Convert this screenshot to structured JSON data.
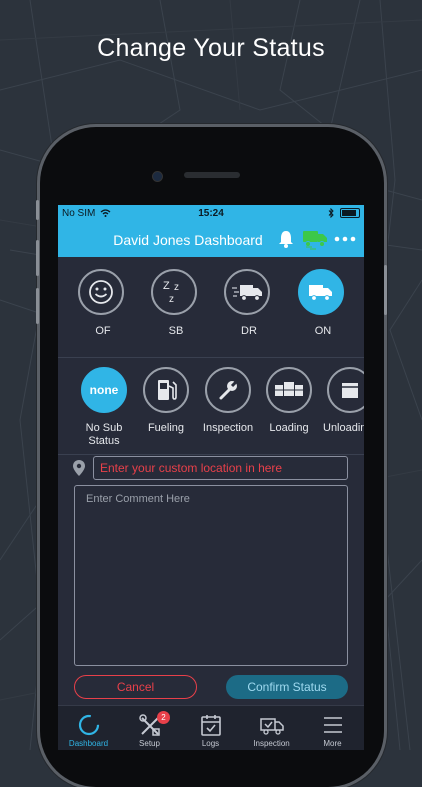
{
  "headline": "Change Your Status",
  "status_bar": {
    "carrier": "No SIM",
    "time": "15:24"
  },
  "nav": {
    "title": "David Jones Dashboard"
  },
  "statuses": [
    {
      "code": "OF",
      "icon": "smiley-icon",
      "active": false
    },
    {
      "code": "SB",
      "icon": "sleep-zzz-icon",
      "active": false
    },
    {
      "code": "DR",
      "icon": "moving-truck-icon",
      "active": false
    },
    {
      "code": "ON",
      "icon": "truck-icon",
      "active": true
    }
  ],
  "sub_statuses": [
    {
      "label": "No Sub Status",
      "circle_text": "none",
      "active": true
    },
    {
      "label": "Fueling",
      "icon": "fuel-pump-icon"
    },
    {
      "label": "Inspection",
      "icon": "wrench-icon"
    },
    {
      "label": "Loading",
      "icon": "boxes-icon"
    },
    {
      "label": "Unloading",
      "icon": "box-icon"
    }
  ],
  "location": {
    "placeholder": "Enter your custom location in here"
  },
  "comment": {
    "placeholder": "Enter Comment Here"
  },
  "buttons": {
    "cancel": "Cancel",
    "confirm": "Confirm Status"
  },
  "tabs": [
    {
      "label": "Dashboard",
      "active": true
    },
    {
      "label": "Setup",
      "badge": "2"
    },
    {
      "label": "Logs"
    },
    {
      "label": "Inspection"
    },
    {
      "label": "More"
    }
  ],
  "colors": {
    "accent": "#30b5e6",
    "danger": "#e8404a",
    "background": "#272b39",
    "success": "#3cc84a"
  }
}
